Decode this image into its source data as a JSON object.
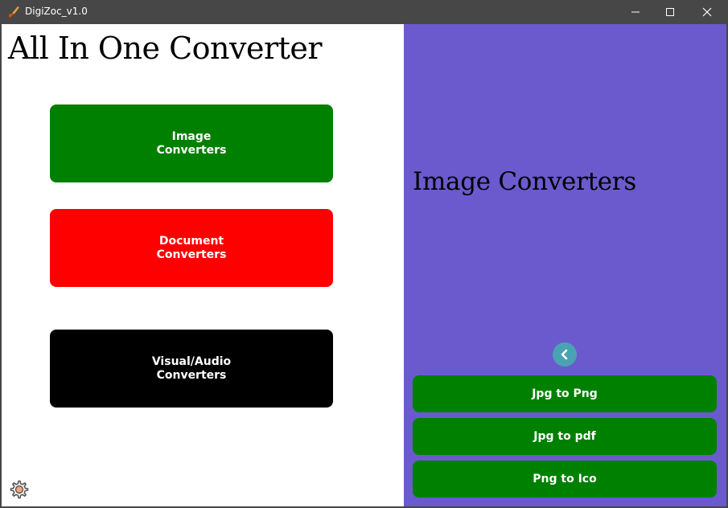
{
  "window": {
    "title": "DigiZoc_v1.0",
    "app_icon": "quill-icon"
  },
  "left": {
    "app_title": "All In One Converter",
    "buttons": [
      {
        "label": "Image\nConverters",
        "color": "#008000"
      },
      {
        "label": "Document\nConverters",
        "color": "#ff0000"
      },
      {
        "label": "Visual/Audio\nConverters",
        "color": "#000000"
      }
    ],
    "settings_icon": "gear-icon"
  },
  "right": {
    "background": "#6a5acd",
    "section_title": "Image Converters",
    "back_icon": "chevron-left-icon",
    "converters": [
      {
        "label": "Jpg to Png"
      },
      {
        "label": "Jpg to pdf"
      },
      {
        "label": "Png to Ico"
      }
    ]
  },
  "colors": {
    "titlebar": "#474747",
    "converter_button": "#008000",
    "back_button": "#4aa3b3"
  }
}
